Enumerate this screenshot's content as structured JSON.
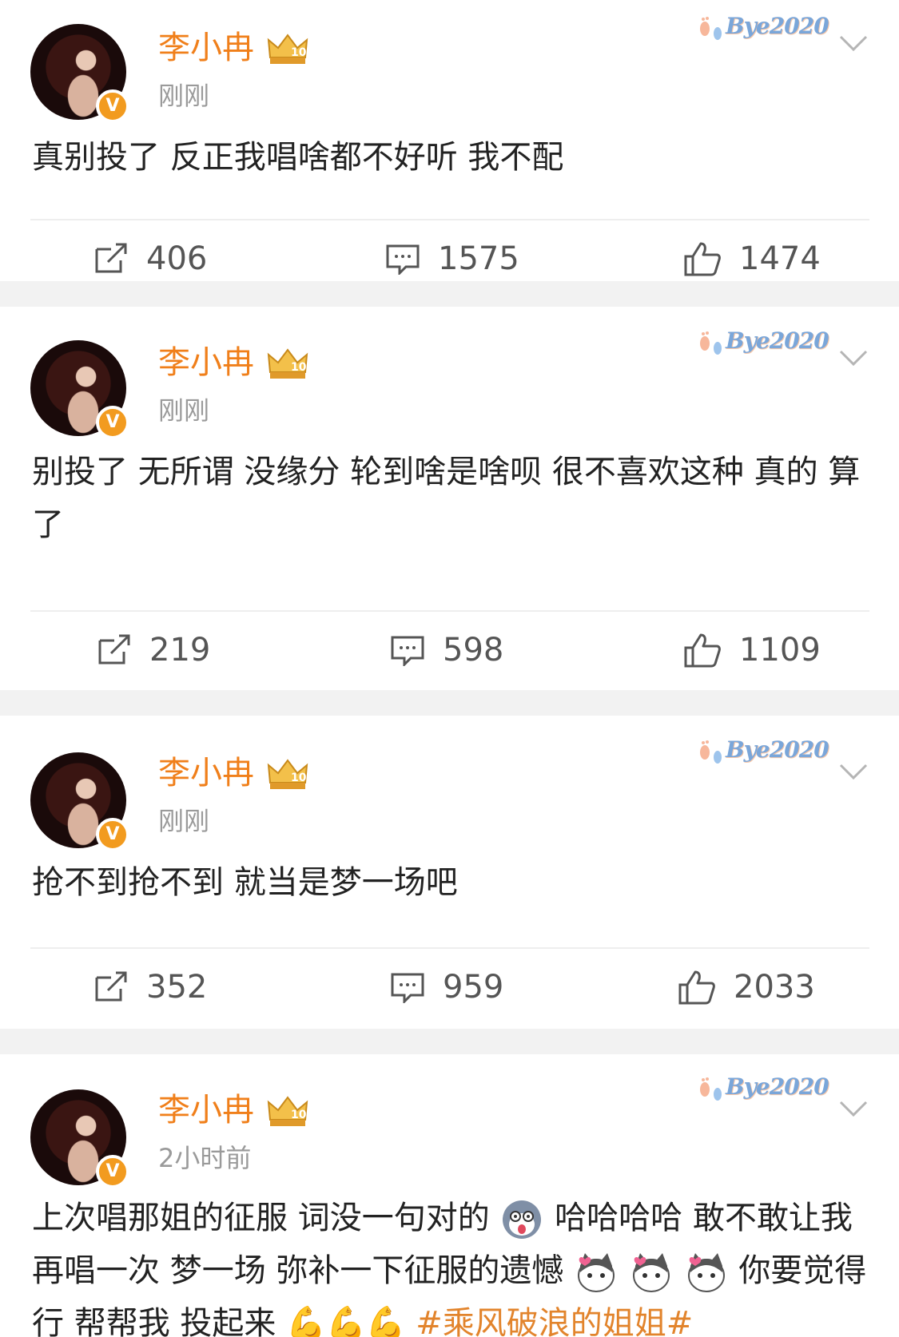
{
  "posts": [
    {
      "username": "李小冉",
      "time": "刚刚",
      "badge": "Bye2020",
      "text": "真别投了 反正我唱啥都不好听 我不配",
      "repost": "406",
      "comment": "1575",
      "like": "1474"
    },
    {
      "username": "李小冉",
      "time": "刚刚",
      "badge": "Bye2020",
      "text": "别投了 无所谓 没缘分 轮到啥是啥呗 很不喜欢这种 真的 算了",
      "repost": "219",
      "comment": "598",
      "like": "1109"
    },
    {
      "username": "李小冉",
      "time": "刚刚",
      "badge": "Bye2020",
      "text": "抢不到抢不到 就当是梦一场吧",
      "repost": "352",
      "comment": "959",
      "like": "2033"
    },
    {
      "username": "李小冉",
      "time": "2小时前",
      "badge": "Bye2020",
      "text_part1": "上次唱那姐的征服 词没一句对的",
      "text_part2": "哈哈哈哈 敢不敢让我再唱一次 梦一场 弥补一下征服的遗憾",
      "text_part3": "你要觉得行 帮帮我 投起来",
      "muscles": "💪💪💪",
      "topic": "#乘风破浪的姐姐#"
    }
  ],
  "icons": {
    "crown": "crown-icon",
    "verified": "verified-v-icon",
    "chevron": "chevron-down-icon",
    "repost": "repost-icon",
    "comment": "comment-icon",
    "like": "thumbs-up-icon"
  },
  "colors": {
    "username": "#f07f1a",
    "verified": "#f29b1f",
    "topic": "#e2842c"
  }
}
